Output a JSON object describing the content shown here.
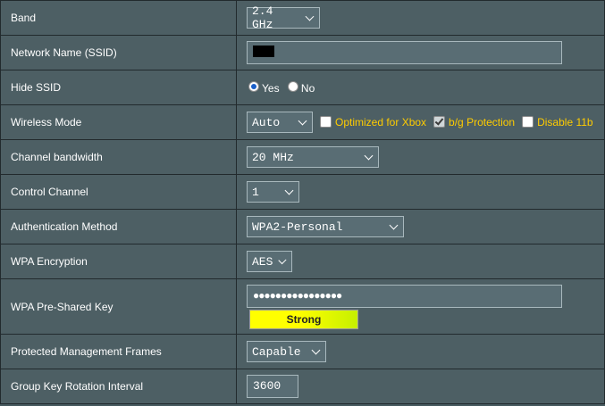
{
  "rows": {
    "band": {
      "label": "Band",
      "value": "2.4 GHz"
    },
    "ssid": {
      "label": "Network Name (SSID)"
    },
    "hide_ssid": {
      "label": "Hide SSID",
      "options": [
        "Yes",
        "No"
      ],
      "selected": "Yes"
    },
    "wireless_mode": {
      "label": "Wireless Mode",
      "value": "Auto",
      "checkboxes": [
        {
          "label": "Optimized for Xbox",
          "checked": false
        },
        {
          "label": "b/g Protection",
          "checked": true
        },
        {
          "label": "Disable 11b",
          "checked": false
        }
      ]
    },
    "channel_bandwidth": {
      "label": "Channel bandwidth",
      "value": "20 MHz"
    },
    "control_channel": {
      "label": "Control Channel",
      "value": "1"
    },
    "auth_method": {
      "label": "Authentication Method",
      "value": "WPA2-Personal"
    },
    "wpa_encryption": {
      "label": "WPA Encryption",
      "value": "AES"
    },
    "wpa_psk": {
      "label": "WPA Pre-Shared Key",
      "value": "●●●●●●●●●●●●●●●●",
      "strength": "Strong"
    },
    "pmf": {
      "label": "Protected Management Frames",
      "value": "Capable"
    },
    "group_key": {
      "label": "Group Key Rotation Interval",
      "value": "3600"
    }
  },
  "colors": {
    "background": "#4d5f64",
    "border": "#222a2d",
    "option_text": "#ffcc00",
    "strength_fill": "#ffff00"
  }
}
